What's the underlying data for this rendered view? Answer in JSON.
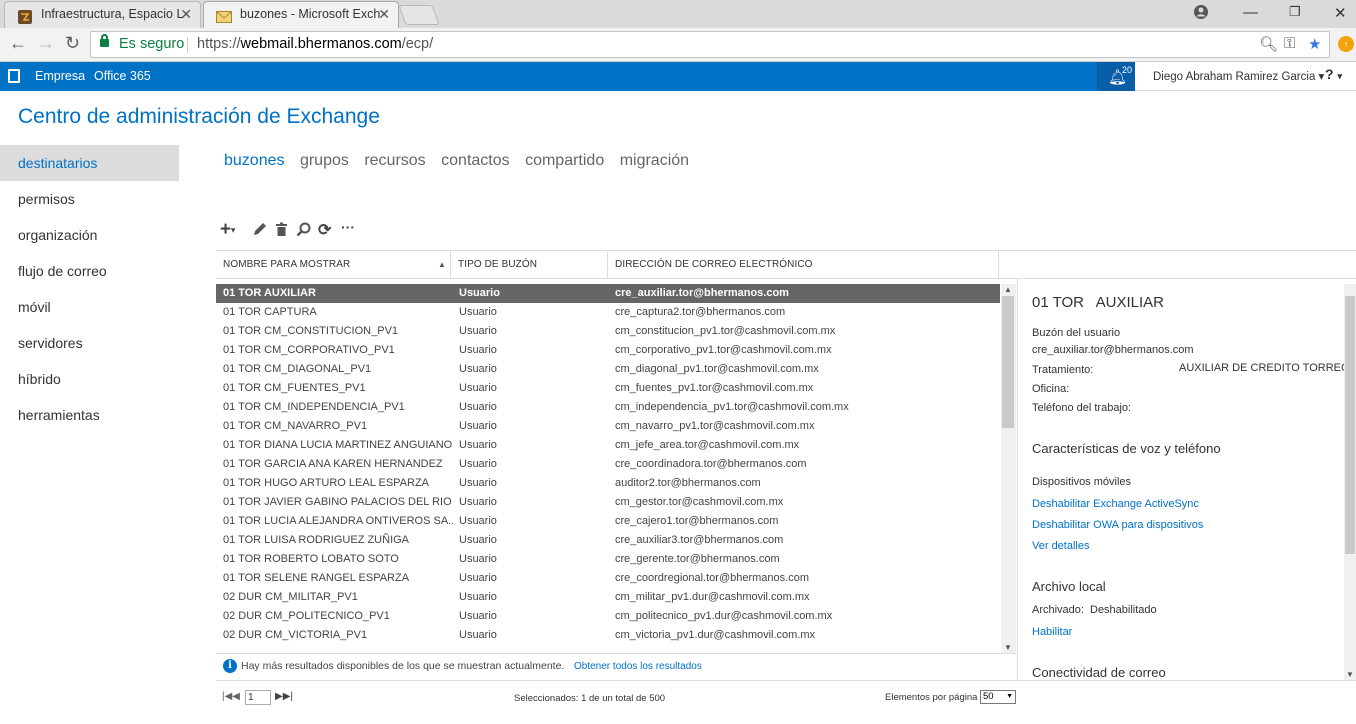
{
  "browser": {
    "tabs": [
      {
        "title": "Infraestructura, Espacio L",
        "active": false,
        "favicon": "orange-logo-icon"
      },
      {
        "title": "buzones - Microsoft Exch",
        "active": true,
        "favicon": "envelope-icon"
      }
    ],
    "security_label": "Es seguro",
    "url_scheme": "https://",
    "url_host": "webmail.bhermanos.com",
    "url_path": "/ecp/"
  },
  "topbar": {
    "nav": [
      "Empresa",
      "Office 365"
    ],
    "notification_count": "20",
    "user": "Diego Abraham Ramirez Garcia",
    "help": "?"
  },
  "app_title": "Centro de administración de Exchange",
  "leftnav": [
    {
      "label": "destinatarios",
      "selected": true
    },
    {
      "label": "permisos"
    },
    {
      "label": "organización"
    },
    {
      "label": "flujo de correo"
    },
    {
      "label": "móvil"
    },
    {
      "label": "servidores"
    },
    {
      "label": "híbrido"
    },
    {
      "label": "herramientas"
    }
  ],
  "tabs": [
    {
      "label": "buzones",
      "selected": true
    },
    {
      "label": "grupos"
    },
    {
      "label": "recursos"
    },
    {
      "label": "contactos"
    },
    {
      "label": "compartido"
    },
    {
      "label": "migración"
    }
  ],
  "toolbar_icons": [
    "add-icon",
    "edit-icon",
    "delete-icon",
    "search-icon",
    "refresh-icon",
    "more-icon"
  ],
  "grid": {
    "columns": [
      "NOMBRE PARA MOSTRAR",
      "TIPO DE BUZÓN",
      "DIRECCIÓN DE CORREO ELECTRÓNICO"
    ],
    "rows": [
      {
        "name": "01 TOR   AUXILIAR",
        "type": "Usuario",
        "email": "cre_auxiliar.tor@bhermanos.com",
        "selected": true
      },
      {
        "name": "01 TOR   CAPTURA",
        "type": "Usuario",
        "email": "cre_captura2.tor@bhermanos.com"
      },
      {
        "name": "01 TOR   CM_CONSTITUCION_PV1",
        "type": "Usuario",
        "email": "cm_constitucion_pv1.tor@cashmovil.com.mx"
      },
      {
        "name": "01 TOR   CM_CORPORATIVO_PV1",
        "type": "Usuario",
        "email": "cm_corporativo_pv1.tor@cashmovil.com.mx"
      },
      {
        "name": "01 TOR   CM_DIAGONAL_PV1",
        "type": "Usuario",
        "email": "cm_diagonal_pv1.tor@cashmovil.com.mx"
      },
      {
        "name": "01 TOR   CM_FUENTES_PV1",
        "type": "Usuario",
        "email": "cm_fuentes_pv1.tor@cashmovil.com.mx"
      },
      {
        "name": "01 TOR   CM_INDEPENDENCIA_PV1",
        "type": "Usuario",
        "email": "cm_independencia_pv1.tor@cashmovil.com.mx"
      },
      {
        "name": "01 TOR   CM_NAVARRO_PV1",
        "type": "Usuario",
        "email": "cm_navarro_pv1.tor@cashmovil.com.mx"
      },
      {
        "name": "01 TOR   DIANA LUCIA MARTINEZ ANGUIANO",
        "type": "Usuario",
        "email": "cm_jefe_area.tor@cashmovil.com.mx"
      },
      {
        "name": "01 TOR   GARCIA ANA KAREN HERNANDEZ",
        "type": "Usuario",
        "email": "cre_coordinadora.tor@bhermanos.com"
      },
      {
        "name": "01 TOR   HUGO ARTURO LEAL ESPARZA",
        "type": "Usuario",
        "email": "auditor2.tor@bhermanos.com"
      },
      {
        "name": "01 TOR   JAVIER GABINO PALACIOS DEL RIO",
        "type": "Usuario",
        "email": "cm_gestor.tor@cashmovil.com.mx"
      },
      {
        "name": "01 TOR   LUCIA ALEJANDRA ONTIVEROS SA...",
        "type": "Usuario",
        "email": "cre_cajero1.tor@bhermanos.com"
      },
      {
        "name": "01 TOR   LUISA RODRIGUEZ ZUÑIGA",
        "type": "Usuario",
        "email": "cre_auxiliar3.tor@bhermanos.com"
      },
      {
        "name": "01 TOR   ROBERTO LOBATO SOTO",
        "type": "Usuario",
        "email": "cre_gerente.tor@bhermanos.com"
      },
      {
        "name": "01 TOR   SELENE RANGEL ESPARZA",
        "type": "Usuario",
        "email": "cre_coordregional.tor@bhermanos.com"
      },
      {
        "name": "02 DUR   CM_MILITAR_PV1",
        "type": "Usuario",
        "email": "cm_militar_pv1.dur@cashmovil.com.mx"
      },
      {
        "name": "02 DUR   CM_POLITECNICO_PV1",
        "type": "Usuario",
        "email": "cm_politecnico_pv1.dur@cashmovil.com.mx"
      },
      {
        "name": "02 DUR   CM_VICTORIA_PV1",
        "type": "Usuario",
        "email": "cm_victoria_pv1.dur@cashmovil.com.mx"
      }
    ],
    "info_text": "Hay más resultados disponibles de los que se muestran actualmente.",
    "info_link": "Obtener todos los resultados"
  },
  "pager": {
    "page": "1",
    "selection": "Seleccionados: 1 de un total de 500",
    "per_page_label": "Elementos por página",
    "per_page_value": "50"
  },
  "details": {
    "title": "01 TOR   AUXILIAR",
    "mailbox_label": "Buzón del usuario",
    "mailbox_email": "cre_auxiliar.tor@bhermanos.com",
    "treatment_label": "Tratamiento:",
    "treatment_value": "AUXILIAR DE CREDITO TORREON",
    "office_label": "Oficina:",
    "phone_label": "Teléfono del trabajo:",
    "voice_title": "Características de voz y teléfono",
    "mobile_label": "Dispositivos móviles",
    "link_activesync": "Deshabilitar Exchange ActiveSync",
    "link_owa": "Deshabilitar OWA para dispositivos",
    "link_details": "Ver detalles",
    "archive_title": "Archivo local",
    "archive_label": "Archivado:",
    "archive_value": "Deshabilitado",
    "archive_link": "Habilitar",
    "connectivity_title": "Conectividad de correo"
  },
  "colors": {
    "accent": "#0072c6",
    "selected_row": "#666666",
    "nav_selected": "#dcdcdc",
    "secure": "#0b8043"
  }
}
